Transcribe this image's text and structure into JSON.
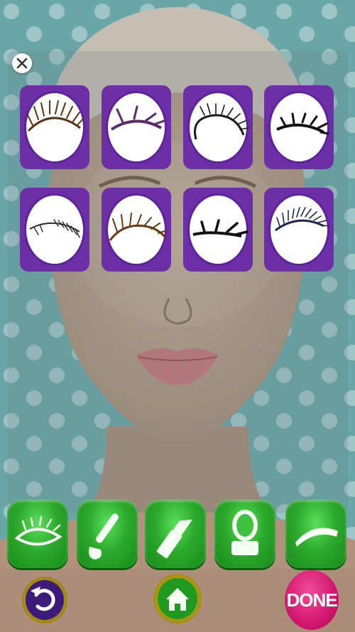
{
  "game": {
    "background_color": "#6aa6a8",
    "panel_color": "#6d2fa6",
    "tool_color": "#2daa2d",
    "done_color": "#d3176f"
  },
  "close_button": {
    "icon": "close-icon"
  },
  "eyelash_options": [
    {
      "id": 1,
      "style": "brown-long",
      "color": "#5a3217"
    },
    {
      "id": 2,
      "style": "purple-spiky",
      "color": "#5a2a6a"
    },
    {
      "id": 3,
      "style": "black-curled",
      "color": "#1a1a1a"
    },
    {
      "id": 4,
      "style": "black-thick-spiky",
      "color": "#111111"
    },
    {
      "id": 5,
      "style": "black-thin-lower",
      "color": "#2a2a2a"
    },
    {
      "id": 6,
      "style": "brown-dramatic",
      "color": "#6a3a12"
    },
    {
      "id": 7,
      "style": "black-wing",
      "color": "#111111"
    },
    {
      "id": 8,
      "style": "navy-dense",
      "color": "#1b2450"
    }
  ],
  "toolbar": [
    {
      "name": "eye-lash-tool",
      "icon": "eye-icon"
    },
    {
      "name": "brush-tool",
      "icon": "brush-icon"
    },
    {
      "name": "lipstick-tool",
      "icon": "lipstick-icon"
    },
    {
      "name": "compact-tool",
      "icon": "compact-mirror-icon"
    },
    {
      "name": "eyebrow-tool",
      "icon": "eyebrow-icon"
    }
  ],
  "bottom": {
    "reset_icon": "reset-icon",
    "home_icon": "home-icon",
    "done_label": "DONE"
  }
}
